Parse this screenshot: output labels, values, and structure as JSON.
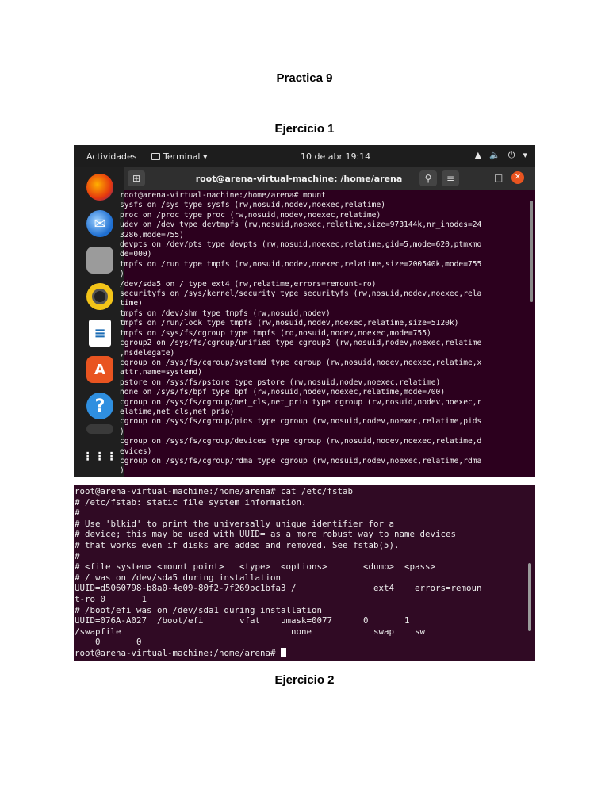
{
  "doc": {
    "title": "Practica 9",
    "section1": "Ejercicio 1",
    "section2": "Ejercicio 2"
  },
  "screenshot1": {
    "topbar": {
      "activities": "Actividades",
      "app": "Terminal ▾",
      "clock": "10 de abr  19:14"
    },
    "window_title": "root@arena-virtual-machine: /home/arena",
    "dock_icons": [
      "firefox-icon",
      "thunderbird-icon",
      "files-icon",
      "rhythmbox-icon",
      "writer-icon",
      "software-icon",
      "help-icon",
      "show-apps-icon"
    ],
    "terminal_text": "root@arena-virtual-machine:/home/arena# mount\nsysfs on /sys type sysfs (rw,nosuid,nodev,noexec,relatime)\nproc on /proc type proc (rw,nosuid,nodev,noexec,relatime)\nudev on /dev type devtmpfs (rw,nosuid,noexec,relatime,size=973144k,nr_inodes=24\n3286,mode=755)\ndevpts on /dev/pts type devpts (rw,nosuid,noexec,relatime,gid=5,mode=620,ptmxmo\nde=000)\ntmpfs on /run type tmpfs (rw,nosuid,nodev,noexec,relatime,size=200540k,mode=755\n)\n/dev/sda5 on / type ext4 (rw,relatime,errors=remount-ro)\nsecurityfs on /sys/kernel/security type securityfs (rw,nosuid,nodev,noexec,rela\ntime)\ntmpfs on /dev/shm type tmpfs (rw,nosuid,nodev)\ntmpfs on /run/lock type tmpfs (rw,nosuid,nodev,noexec,relatime,size=5120k)\ntmpfs on /sys/fs/cgroup type tmpfs (ro,nosuid,nodev,noexec,mode=755)\ncgroup2 on /sys/fs/cgroup/unified type cgroup2 (rw,nosuid,nodev,noexec,relatime\n,nsdelegate)\ncgroup on /sys/fs/cgroup/systemd type cgroup (rw,nosuid,nodev,noexec,relatime,x\nattr,name=systemd)\npstore on /sys/fs/pstore type pstore (rw,nosuid,nodev,noexec,relatime)\nnone on /sys/fs/bpf type bpf (rw,nosuid,nodev,noexec,relatime,mode=700)\ncgroup on /sys/fs/cgroup/net_cls,net_prio type cgroup (rw,nosuid,nodev,noexec,r\nelatime,net_cls,net_prio)\ncgroup on /sys/fs/cgroup/pids type cgroup (rw,nosuid,nodev,noexec,relatime,pids\n)\ncgroup on /sys/fs/cgroup/devices type cgroup (rw,nosuid,nodev,noexec,relatime,d\nevices)\ncgroup on /sys/fs/cgroup/rdma type cgroup (rw,nosuid,nodev,noexec,relatime,rdma\n)"
  },
  "screenshot2": {
    "terminal_text": "root@arena-virtual-machine:/home/arena# cat /etc/fstab\n# /etc/fstab: static file system information.\n#\n# Use 'blkid' to print the universally unique identifier for a\n# device; this may be used with UUID= as a more robust way to name devices\n# that works even if disks are added and removed. See fstab(5).\n#\n# <file system> <mount point>   <type>  <options>       <dump>  <pass>\n# / was on /dev/sda5 during installation\nUUID=d5060798-b8a0-4e09-80f2-7f269bc1bfa3 /               ext4    errors=remoun\nt-ro 0       1\n# /boot/efi was on /dev/sda1 during installation\nUUID=076A-A027  /boot/efi       vfat    umask=0077      0       1\n/swapfile                                 none            swap    sw\n    0       0",
    "prompt": "root@arena-virtual-machine:/home/arena# "
  }
}
